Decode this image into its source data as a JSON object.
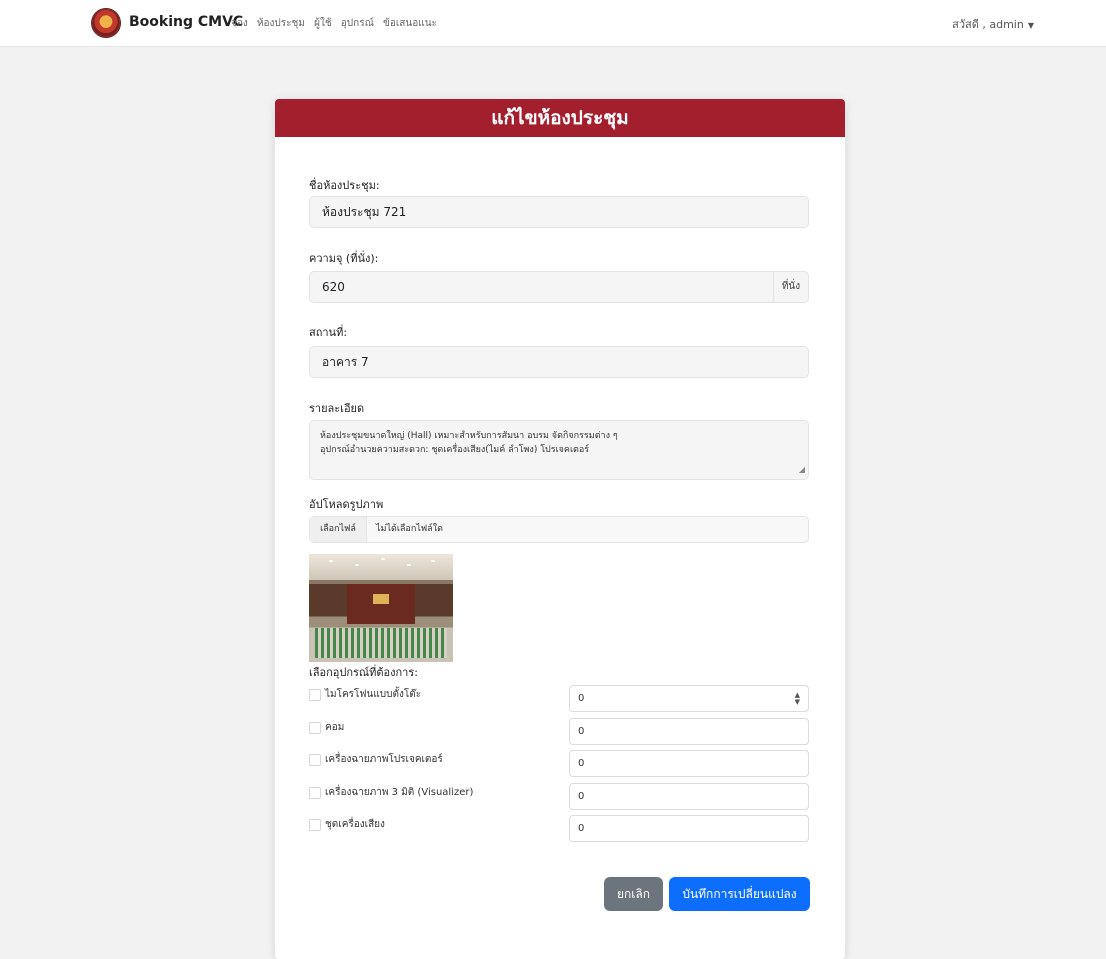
{
  "navbar": {
    "brand": "Booking CMVC",
    "links": [
      "จอง",
      "ห้องประชุม",
      "ผู้ใช้",
      "อุปกรณ์",
      "ข้อเสนอแนะ"
    ],
    "user": "สวัสดี , admin"
  },
  "form": {
    "title": "แก้ไขห้องประชุม",
    "room_name_label": "ชื่อห้องประชุม:",
    "room_name_value": "ห้องประชุม 721",
    "capacity_label": "ความจุ (ที่นั่ง):",
    "capacity_value": "620",
    "capacity_suffix": "ที่นั่ง",
    "location_label": "สถานที่:",
    "location_value": "อาคาร 7",
    "details_label": "รายละเอียด",
    "details_line1": "ห้องประชุมขนาดใหญ่ (Hall) เหมาะสำหรับการสัมนา อบรม จัดกิจกรรมต่าง ๆ",
    "details_line2": "อุปกรณ์อำนวยความสะดวก: ชุดเครื่องเสียง(ไมค์ ลำโพง) โปรเจคเตอร์",
    "upload_label": "อัปโหลดรูปภาพ",
    "file_button": "เลือกไฟล์",
    "file_status": "ไม่ได้เลือกไฟล์ใด",
    "equipment_label": "เลือกอุปกรณ์ที่ต้องการ:",
    "equipment": [
      {
        "name": "ไมโครโฟนแบบตั้งโต๊ะ",
        "qty": "0"
      },
      {
        "name": "คอม",
        "qty": "0"
      },
      {
        "name": "เครื่องฉายภาพโปรเจคเตอร์",
        "qty": "0"
      },
      {
        "name": "เครื่องฉายภาพ 3 มิติ (Visualizer)",
        "qty": "0"
      },
      {
        "name": "ชุดเครื่องเสียง",
        "qty": "0"
      }
    ],
    "cancel_label": "ยกเลิก",
    "save_label": "บันทึกการเปลี่ยนแปลง"
  },
  "colors": {
    "header": "#a31f2e",
    "primary": "#0d6efd",
    "secondary": "#6c757d"
  }
}
